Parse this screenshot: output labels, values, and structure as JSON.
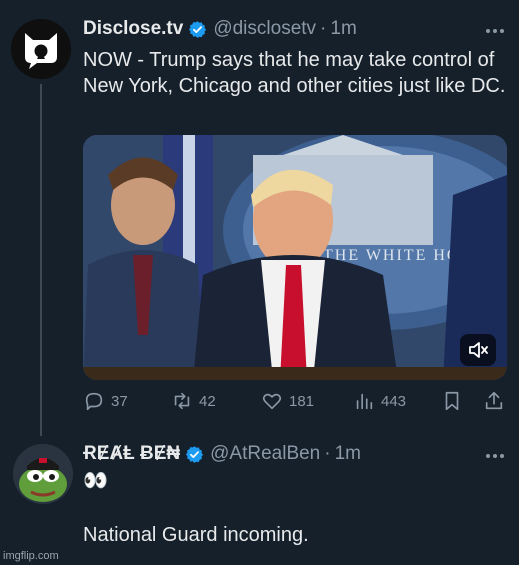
{
  "tweet1": {
    "display_name": "Disclose.tv",
    "handle": "@disclosetv",
    "separator": "·",
    "time": "1m",
    "text": "NOW - Trump says that he may take control of New York, Chicago and other cities just like DC.",
    "avatar_icon": "disclosetv-logo-icon",
    "video_overlay": {
      "mute_icon": "volume-muted-icon",
      "banner_text": "THE WHITE HOUSE"
    },
    "actions": [
      {
        "icon": "reply-icon",
        "count": "37"
      },
      {
        "icon": "retweet-icon",
        "count": "42"
      },
      {
        "icon": "like-icon",
        "count": "181"
      },
      {
        "icon": "views-icon",
        "count": "443"
      },
      {
        "icon": "bookmark-icon"
      },
      {
        "icon": "share-icon"
      }
    ]
  },
  "tweet2": {
    "display_name": "ɌɆȺⱠ ɃɆ₦",
    "handle": "@AtRealBen",
    "separator": "·",
    "time": "1m",
    "emoji_line": "👀",
    "text": "National Guard incoming."
  },
  "watermark": "imgflip.com",
  "colors": {
    "background": "#15202b",
    "text": "#e7e9ea",
    "muted": "#8b98a5",
    "verified": "#1d9bf0",
    "thread_line": "#3d4a56"
  }
}
